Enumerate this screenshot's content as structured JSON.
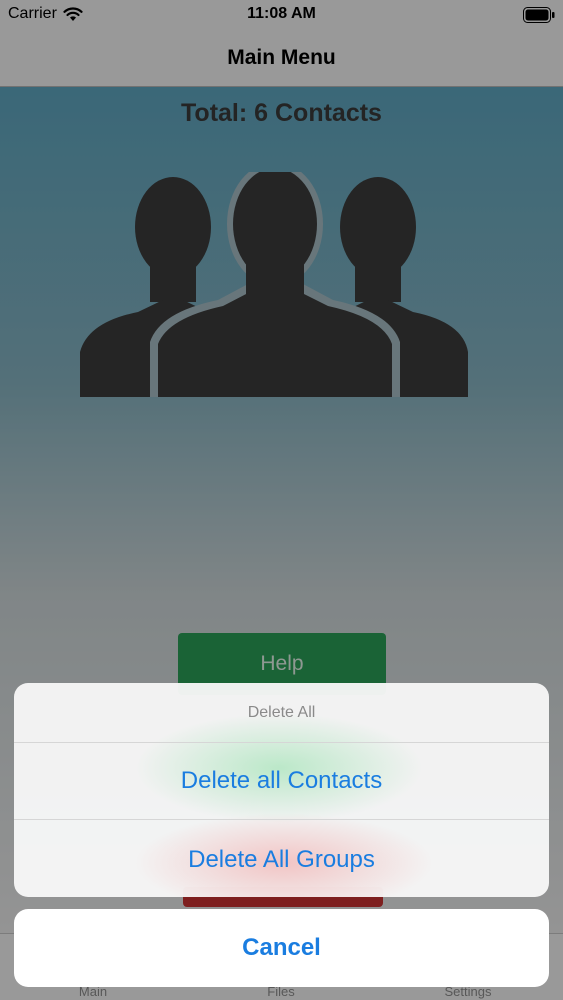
{
  "status_bar": {
    "carrier": "Carrier",
    "time": "11:08 AM"
  },
  "nav": {
    "title": "Main Menu"
  },
  "content": {
    "total_label": "Total: 6 Contacts",
    "help_label": "Help"
  },
  "tabs": [
    {
      "label": "Main"
    },
    {
      "label": "Files"
    },
    {
      "label": "Settings"
    }
  ],
  "action_sheet": {
    "title": "Delete All",
    "actions": [
      {
        "label": "Delete all Contacts"
      },
      {
        "label": "Delete All Groups"
      }
    ],
    "cancel_label": "Cancel"
  },
  "colors": {
    "accent": "#1a7de0",
    "help_button": "#2aa157",
    "gradient_top": "#5fa8c2"
  },
  "icons": [
    "wifi-icon",
    "battery-icon",
    "contacts-group-icon"
  ]
}
